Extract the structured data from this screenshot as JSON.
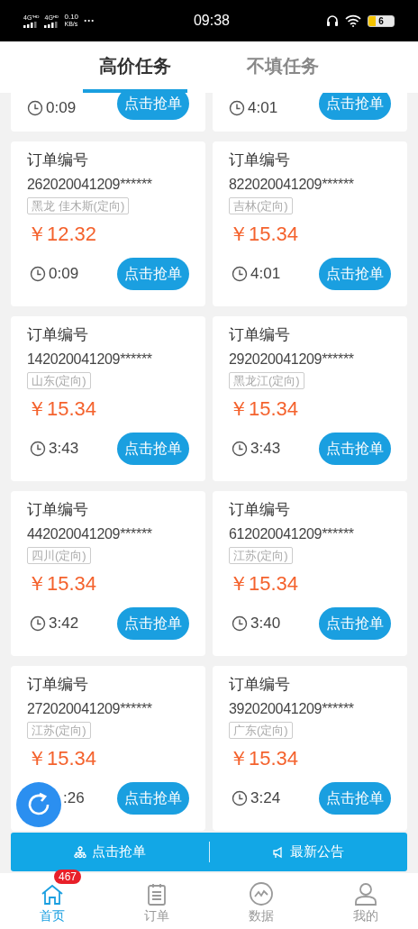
{
  "status_bar": {
    "network_1": "4G⁺ᴴᴰ",
    "network_2": "4Gᴴᴰ",
    "speed_value": "0.10",
    "speed_unit": "KB/s",
    "more": "···",
    "time": "09:38",
    "battery": "6"
  },
  "tabs": [
    {
      "label": "高价任务",
      "selected": true
    },
    {
      "label": "不填任务",
      "selected": false
    }
  ],
  "partial_row": [
    {
      "time": "0:09",
      "button": "点击抢单"
    },
    {
      "time": "4:01",
      "button": "点击抢单"
    }
  ],
  "orders": [
    {
      "title": "订单编号",
      "number": "262020041209******",
      "tag": "黑龙 佳木斯(定向)",
      "price": "￥12.32",
      "time": "0:09",
      "clock_icon": true,
      "button": "点击抢单"
    },
    {
      "title": "订单编号",
      "number": "822020041209******",
      "tag": "吉林(定向)",
      "price": "￥15.34",
      "time": "4:01",
      "clock_icon": true,
      "button": "点击抢单"
    },
    {
      "title": "订单编号",
      "number": "142020041209******",
      "tag": "山东(定向)",
      "price": "￥15.34",
      "time": "3:43",
      "clock_icon": true,
      "button": "点击抢单"
    },
    {
      "title": "订单编号",
      "number": "292020041209******",
      "tag": "黑龙江(定向)",
      "price": "￥15.34",
      "time": "3:43",
      "clock_icon": true,
      "button": "点击抢单"
    },
    {
      "title": "订单编号",
      "number": "442020041209******",
      "tag": "四川(定向)",
      "price": "￥15.34",
      "time": "3:42",
      "clock_icon": true,
      "button": "点击抢单"
    },
    {
      "title": "订单编号",
      "number": "612020041209******",
      "tag": "江苏(定向)",
      "price": "￥15.34",
      "time": "3:40",
      "clock_icon": true,
      "button": "点击抢单"
    },
    {
      "title": "订单编号",
      "number": "272020041209******",
      "tag": "江苏(定向)",
      "price": "￥15.34",
      "time": ":26",
      "clock_icon": false,
      "button": "点击抢单"
    },
    {
      "title": "订单编号",
      "number": "392020041209******",
      "tag": "广东(定向)",
      "price": "￥15.34",
      "time": "3:24",
      "clock_icon": true,
      "button": "点击抢单"
    }
  ],
  "action_bar": [
    {
      "kind": "grab",
      "label": "点击抢单"
    },
    {
      "kind": "notice",
      "label": "最新公告"
    }
  ],
  "nav": [
    {
      "kind": "home",
      "label": "首页",
      "selected": true,
      "badge": "467"
    },
    {
      "kind": "orders",
      "label": "订单",
      "selected": false
    },
    {
      "kind": "data",
      "label": "数据",
      "selected": false
    },
    {
      "kind": "profile",
      "label": "我的",
      "selected": false
    }
  ]
}
